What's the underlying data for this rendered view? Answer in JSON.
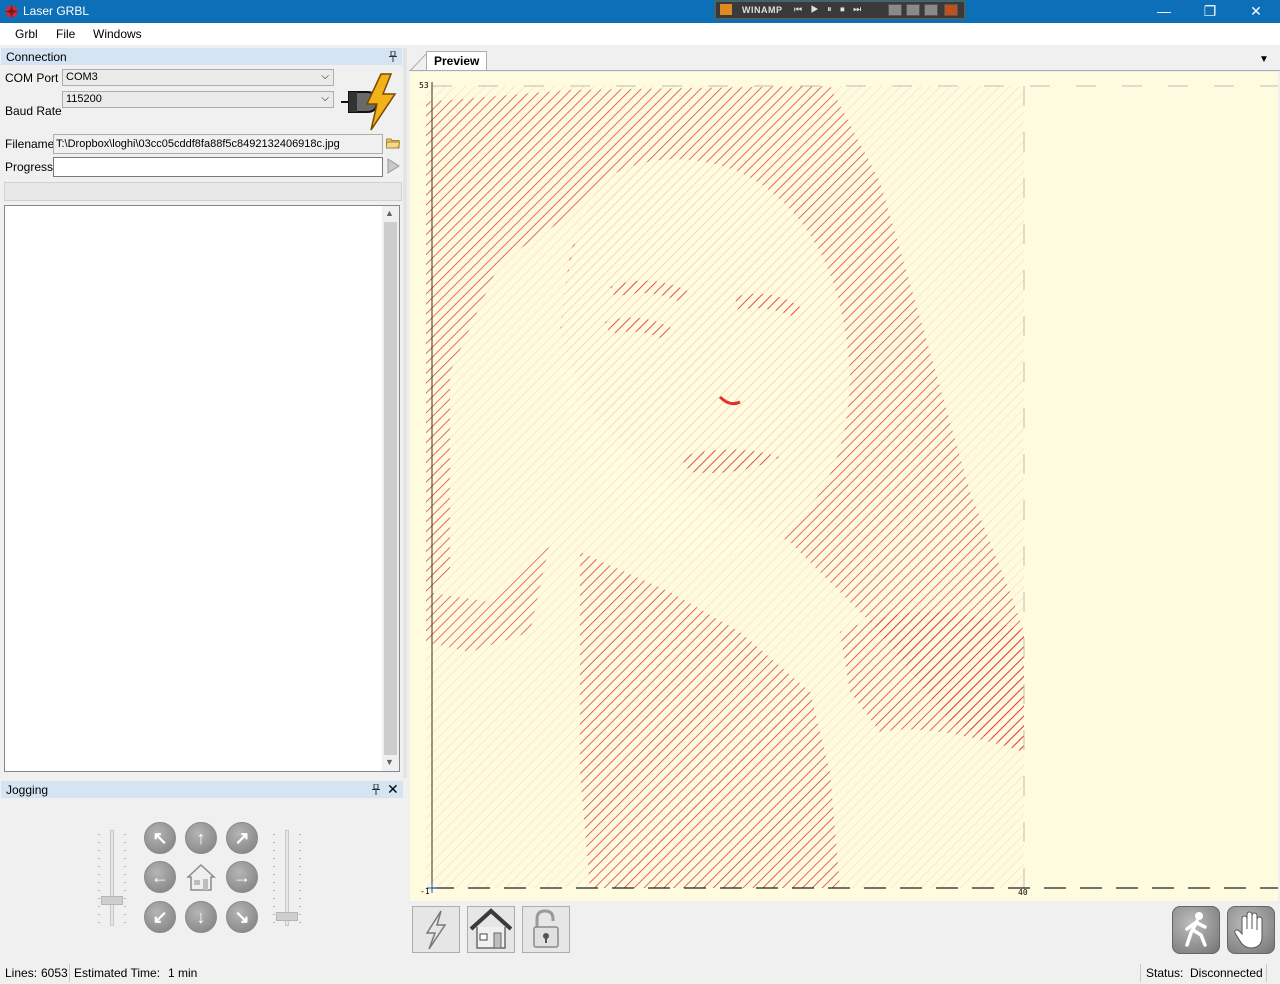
{
  "window": {
    "title": "Laser GRBL",
    "winamp_title": "WINAMP",
    "winamp_controls": "⏮ ▶ ⏸ ⏹ ⏭",
    "minimize": "—",
    "maximize": "❐",
    "close": "✕"
  },
  "menu": {
    "items": [
      "Grbl",
      "File",
      "Windows"
    ]
  },
  "connection": {
    "title": "Connection",
    "com_port_label": "COM Port",
    "com_port_value": "COM3",
    "baud_rate_label": "Baud Rate",
    "baud_rate_value": "115200",
    "filename_label": "Filename",
    "filename_value": "T:\\Dropbox\\loghi\\03cc05cddf8fa88f5c8492132406918c.jpg",
    "progress_label": "Progress",
    "progress_fraction": 0
  },
  "jogging": {
    "title": "Jogging"
  },
  "preview": {
    "tab_label": "Preview",
    "axis_y_max": "53",
    "axis_origin": "-1",
    "axis_x_mark": "40",
    "image_description_icon": "engraving-preview-image",
    "accent_color": "#e03030",
    "background_color": "#fffbdf"
  },
  "status": {
    "lines_label": "Lines:",
    "lines_value": "6053",
    "time_label": "Estimated Time:",
    "time_value": "1 min",
    "status_label": "Status:",
    "status_value": "Disconnected"
  }
}
